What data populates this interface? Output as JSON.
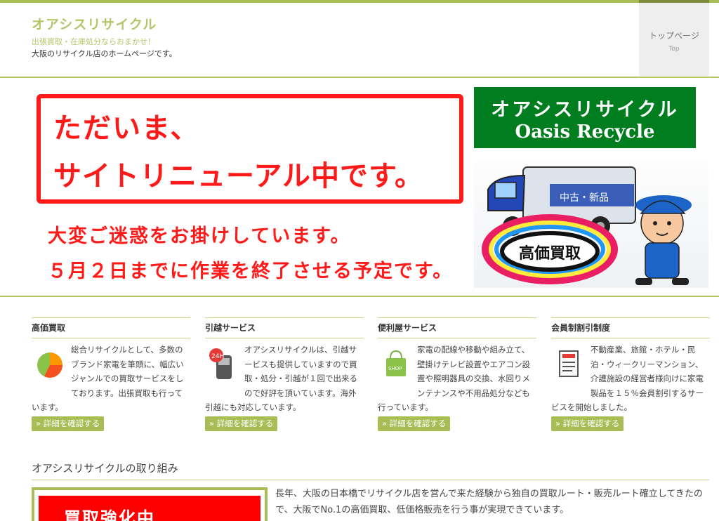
{
  "header": {
    "site_title": "オアシスリサイクル",
    "tagline": "出張買取・在庫処分ならおまかせ！",
    "description": "大阪のリサイクル店のホームページです。",
    "nav": {
      "top_jp": "トップページ",
      "top_en": "Top"
    }
  },
  "banner": {
    "notice_line1": "ただいま、",
    "notice_line2": "サイトリニューアル中です。",
    "apology_line1": "大変ご迷惑をお掛けしています。",
    "apology_line2": "５月２日までに作業を終了させる予定です。",
    "logo_jp": "オアシスリサイクル",
    "logo_en": "Oasis Recycle",
    "truck_label": "中古・新品",
    "sign_text": "高価買取"
  },
  "services": [
    {
      "title": "高価買取",
      "text": "総合リサイクルとして、多数のブランド家電を筆頭に、幅広いジャンルでの買取サービスをしております。出張買取も行っています。",
      "button": "» 詳細を確認する",
      "icon": "pie-chart-icon"
    },
    {
      "title": "引越サービス",
      "text": "オアシスリサイクルは、引越サービスも提供していますので買取・処分・引越が１回で出来るので好評を頂いています。海外引越にも対応しています。",
      "button": "» 詳細を確認する",
      "icon": "mobile-phone-24h-icon"
    },
    {
      "title": "便利屋サービス",
      "text": "家電の配線や移動や組み立て、壁掛けテレビ設置やエアコン設置や照明器具の交換、水回りメンテナンスや不用品処分なども行っています。",
      "button": "» 詳細を確認する",
      "icon": "shopping-bag-icon"
    },
    {
      "title": "会員制割引制度",
      "text": "不動産業、旅館・ホテル・民泊・ウィークリーマンション、介護施設の経営者様向けに家電製品を１５％会員割引するサービスを開始しました。",
      "button": "» 詳細を確認する",
      "icon": "document-list-icon"
    }
  ],
  "section": {
    "title": "オアシスリサイクルの取り組み",
    "promo_text": "買取強化中",
    "body": "長年、大阪の日本橋でリサイクル店を営んで来た経験から独自の買取ルート・販売ルート確立してきたので、大阪でNo.1の高価買取、低価格販売を行う事が実現できています。"
  },
  "colors": {
    "accent": "#a8bd55",
    "title": "#b5c56a",
    "alert_red": "#ff1a1a",
    "logo_green": "#007d1f"
  }
}
